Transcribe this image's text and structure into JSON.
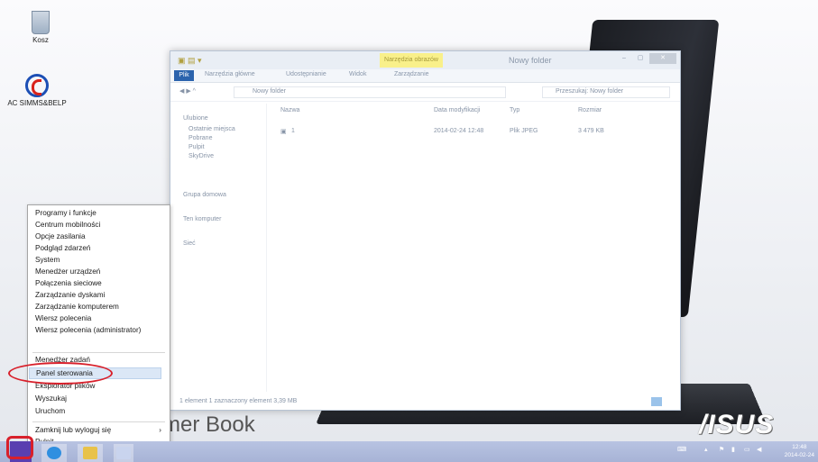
{
  "desktop": {
    "icons": [
      {
        "label": "Kosz"
      },
      {
        "label": "AC SIMMS&BELP"
      }
    ],
    "wallpaper_text": "mer Book",
    "brand": "/ISUS"
  },
  "explorer": {
    "title": "Nowy folder",
    "context_tab": "Narzędzia obrazów",
    "ribbon_tabs": [
      "Plik",
      "Narzędzia główne",
      "Udostępnianie",
      "Widok",
      "Zarządzanie"
    ],
    "address": "Nowy folder",
    "search_placeholder": "Przeszukaj: Nowy folder",
    "nav": [
      "Ulubione",
      "Ostatnie miejsca",
      "Pobrane",
      "Pulpit",
      "SkyDrive",
      "Grupa domowa",
      "Ten komputer",
      "Sieć"
    ],
    "columns": [
      "Nazwa",
      "Data modyfikacji",
      "Typ",
      "Rozmiar"
    ],
    "file": {
      "name": "1",
      "modified": "2014-02-24 12:48",
      "type": "Plik JPEG",
      "size": "3 479 KB"
    },
    "status": "1 element    1 zaznaczony element  3,39 MB"
  },
  "menu": {
    "items": [
      "Programy i funkcje",
      "Centrum mobilności",
      "Opcje zasilania",
      "Podgląd zdarzeń",
      "System",
      "Menedżer urządzeń",
      "Połączenia sieciowe",
      "Zarządzanie dyskami",
      "Zarządzanie komputerem",
      "Wiersz polecenia",
      "Wiersz polecenia (administrator)",
      "Menedżer zadań",
      "Panel sterowania",
      "Eksplorator plików",
      "Wyszukaj",
      "Uruchom",
      "Zamknij lub wyloguj się",
      "Pulpit"
    ],
    "highlighted": "Panel sterowania",
    "arrow": "›"
  },
  "taskbar": {
    "time": "12:48",
    "date": "2014-02-24"
  },
  "colors": {
    "taskbar": "#a7b3d6",
    "start": "#5a3fb0",
    "annotation": "#d8202b",
    "highlight": "#dbe7f6"
  }
}
